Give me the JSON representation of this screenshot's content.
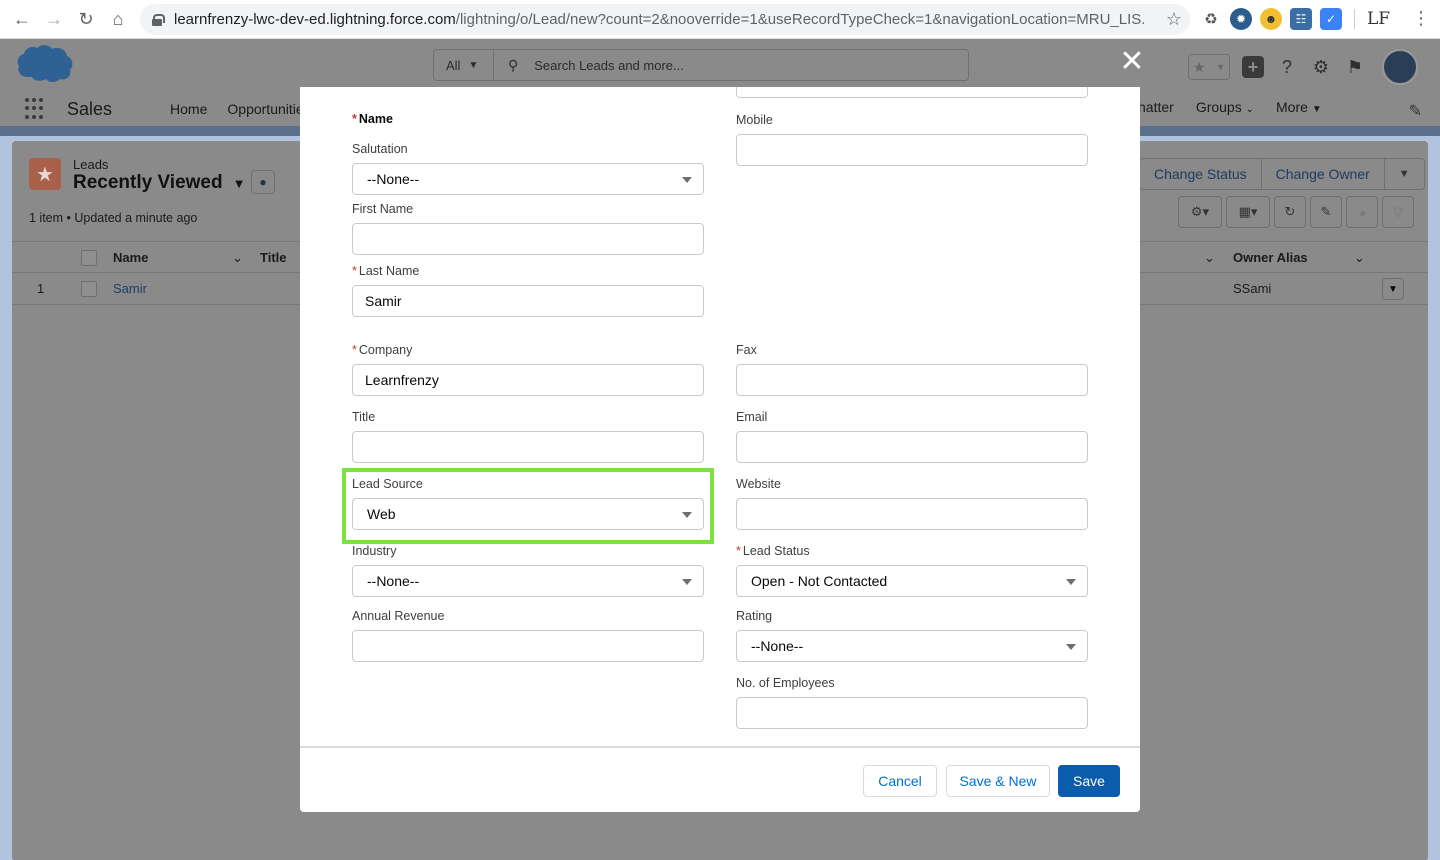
{
  "browser": {
    "url_host": "learnfrenzy-lwc-dev-ed.lightning.force.com",
    "url_path": "/lightning/o/Lead/new?count=2&nooverride=1&useRecordTypeCheck=1&navigationLocation=MRU_LIS...",
    "profile_initials": "LF"
  },
  "header": {
    "search_scope": "All",
    "search_placeholder": "Search Leads and more...",
    "app_name": "Sales",
    "nav_items": [
      "Home",
      "Opportunities"
    ],
    "nav_right": [
      "hatter",
      "Groups",
      "More"
    ]
  },
  "list_view": {
    "object_label": "Leads",
    "view_name": "Recently Viewed",
    "meta": "1 item • Updated a minute ago",
    "actions": [
      "Change Status",
      "Change Owner"
    ],
    "columns": {
      "name": "Name",
      "title": "Title",
      "owner_alias": "Owner Alias"
    },
    "rows": [
      {
        "num": "1",
        "name": "Samir",
        "owner_alias": "SSami"
      }
    ]
  },
  "form": {
    "name_section": "Name",
    "salutation": {
      "label": "Salutation",
      "value": "--None--"
    },
    "first_name": {
      "label": "First Name",
      "value": ""
    },
    "last_name": {
      "label": "Last Name",
      "value": "Samir"
    },
    "mobile": {
      "label": "Mobile",
      "value": ""
    },
    "company": {
      "label": "Company",
      "value": "Learnfrenzy"
    },
    "fax": {
      "label": "Fax",
      "value": ""
    },
    "title": {
      "label": "Title",
      "value": ""
    },
    "email": {
      "label": "Email",
      "value": ""
    },
    "lead_source": {
      "label": "Lead Source",
      "value": "Web"
    },
    "website": {
      "label": "Website",
      "value": ""
    },
    "industry": {
      "label": "Industry",
      "value": "--None--"
    },
    "lead_status": {
      "label": "Lead Status",
      "value": "Open - Not Contacted"
    },
    "annual_revenue": {
      "label": "Annual Revenue",
      "value": ""
    },
    "rating": {
      "label": "Rating",
      "value": "--None--"
    },
    "employees": {
      "label": "No. of Employees",
      "value": ""
    }
  },
  "footer": {
    "cancel": "Cancel",
    "save_new": "Save & New",
    "save": "Save"
  },
  "colors": {
    "brand_button": "#0b5cab",
    "highlight": "#7be042",
    "required": "#c23934"
  }
}
